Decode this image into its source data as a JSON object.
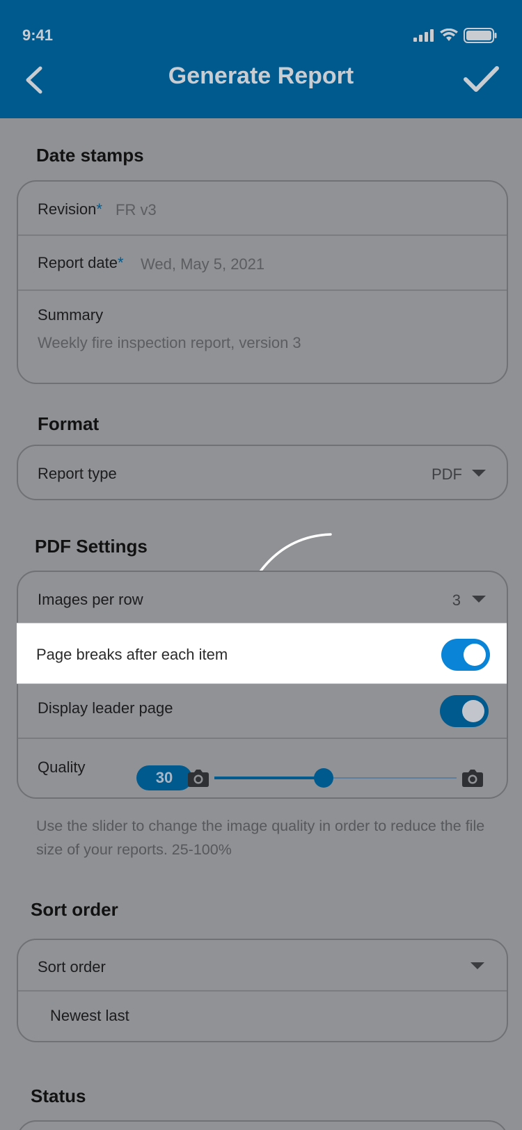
{
  "status_bar": {
    "time": "9:41"
  },
  "header": {
    "title": "Generate Report"
  },
  "date_stamps": {
    "heading": "Date stamps",
    "revision_label": "Revision",
    "revision_value": "FR v3",
    "report_date_label": "Report date",
    "report_date_value": "Wed, May 5, 2021",
    "required_mark": "*",
    "summary_label": "Summary",
    "summary_value": "Weekly fire inspection report, version 3"
  },
  "format": {
    "heading": "Format",
    "report_type_label": "Report type",
    "report_type_value": "PDF"
  },
  "pdf_settings": {
    "heading": "PDF Settings",
    "images_per_row_label": "Images per row",
    "images_per_row_value": "3",
    "page_breaks_label": "Page breaks after each item",
    "page_breaks_on": true,
    "leader_page_label": "Display leader page",
    "leader_page_on": true,
    "quality_label": "Quality",
    "quality_value": "30",
    "quality_fraction": 0.45,
    "helper_text": "Use the slider to change the image quality in order to reduce the file size of your reports. 25-100%"
  },
  "sort_order": {
    "heading": "Sort order",
    "label": "Sort order",
    "selected": "Newest last"
  },
  "status": {
    "heading": "Status"
  },
  "colors": {
    "brand": "#005a8e",
    "toggle_active": "#0a84d6",
    "overlay": "#8f9194"
  }
}
